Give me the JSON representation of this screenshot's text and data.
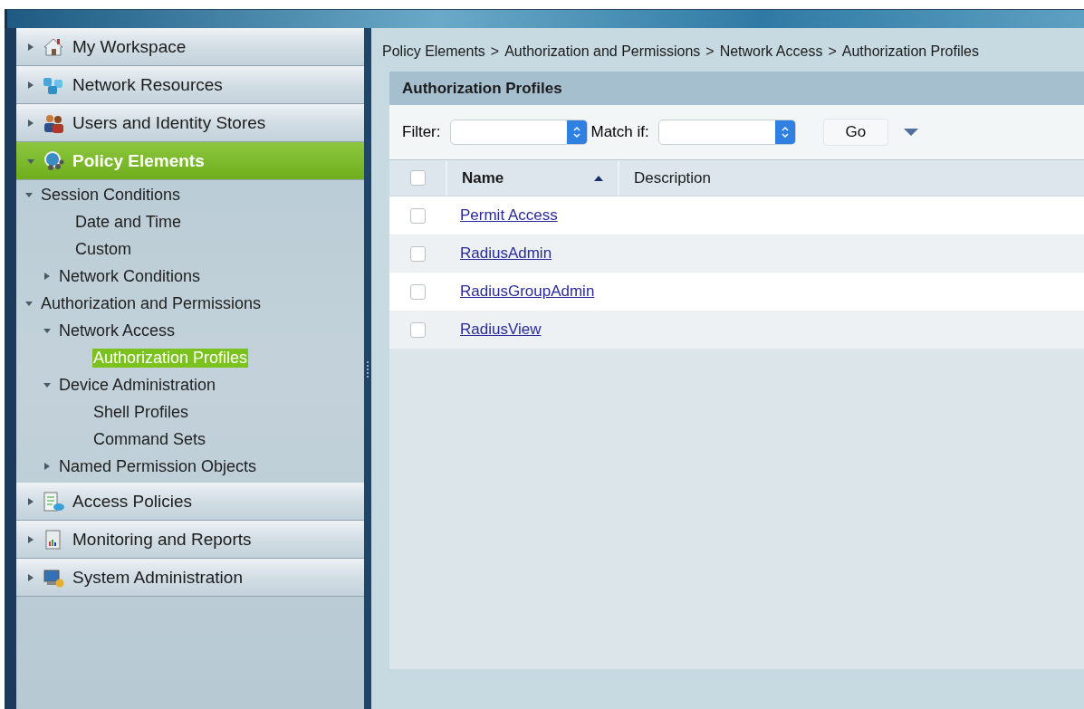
{
  "nav": [
    {
      "label": "My Workspace",
      "expanded": false,
      "selected": false
    },
    {
      "label": "Network Resources",
      "expanded": false,
      "selected": false
    },
    {
      "label": "Users and Identity Stores",
      "expanded": false,
      "selected": false
    },
    {
      "label": "Policy Elements",
      "expanded": true,
      "selected": true,
      "children": [
        {
          "label": "Session Conditions",
          "expanded": true,
          "selected": false,
          "children": [
            {
              "label": "Date and Time",
              "selected": false
            },
            {
              "label": "Custom",
              "selected": false
            },
            {
              "label": "Network Conditions",
              "expanded": false,
              "selected": false
            }
          ]
        },
        {
          "label": "Authorization and Permissions",
          "expanded": true,
          "selected": false,
          "children": [
            {
              "label": "Network Access",
              "expanded": true,
              "selected": false,
              "children": [
                {
                  "label": "Authorization Profiles",
                  "selected": true
                }
              ]
            },
            {
              "label": "Device Administration",
              "expanded": true,
              "selected": false,
              "children": [
                {
                  "label": "Shell Profiles",
                  "selected": false
                },
                {
                  "label": "Command Sets",
                  "selected": false
                }
              ]
            },
            {
              "label": "Named Permission Objects",
              "expanded": false,
              "selected": false
            }
          ]
        }
      ]
    },
    {
      "label": "Access Policies",
      "expanded": false,
      "selected": false
    },
    {
      "label": "Monitoring and Reports",
      "expanded": false,
      "selected": false
    },
    {
      "label": "System Administration",
      "expanded": false,
      "selected": false
    }
  ],
  "breadcrumb": {
    "separator": ">",
    "items": [
      "Policy Elements",
      "Authorization and Permissions",
      "Network Access",
      "Authorization Profiles"
    ]
  },
  "panel": {
    "title": "Authorization Profiles",
    "filter_label": "Filter:",
    "match_label": "Match if:",
    "go_button": "Go",
    "columns": [
      {
        "label": "Name",
        "sorted": true
      },
      {
        "label": "Description",
        "sorted": false
      }
    ],
    "select_all_checked": false,
    "rows": [
      {
        "name": "Permit Access",
        "checked": false
      },
      {
        "name": "RadiusAdmin",
        "checked": false
      },
      {
        "name": "RadiusGroupAdmin",
        "checked": false
      },
      {
        "name": "RadiusView",
        "checked": false
      }
    ]
  }
}
